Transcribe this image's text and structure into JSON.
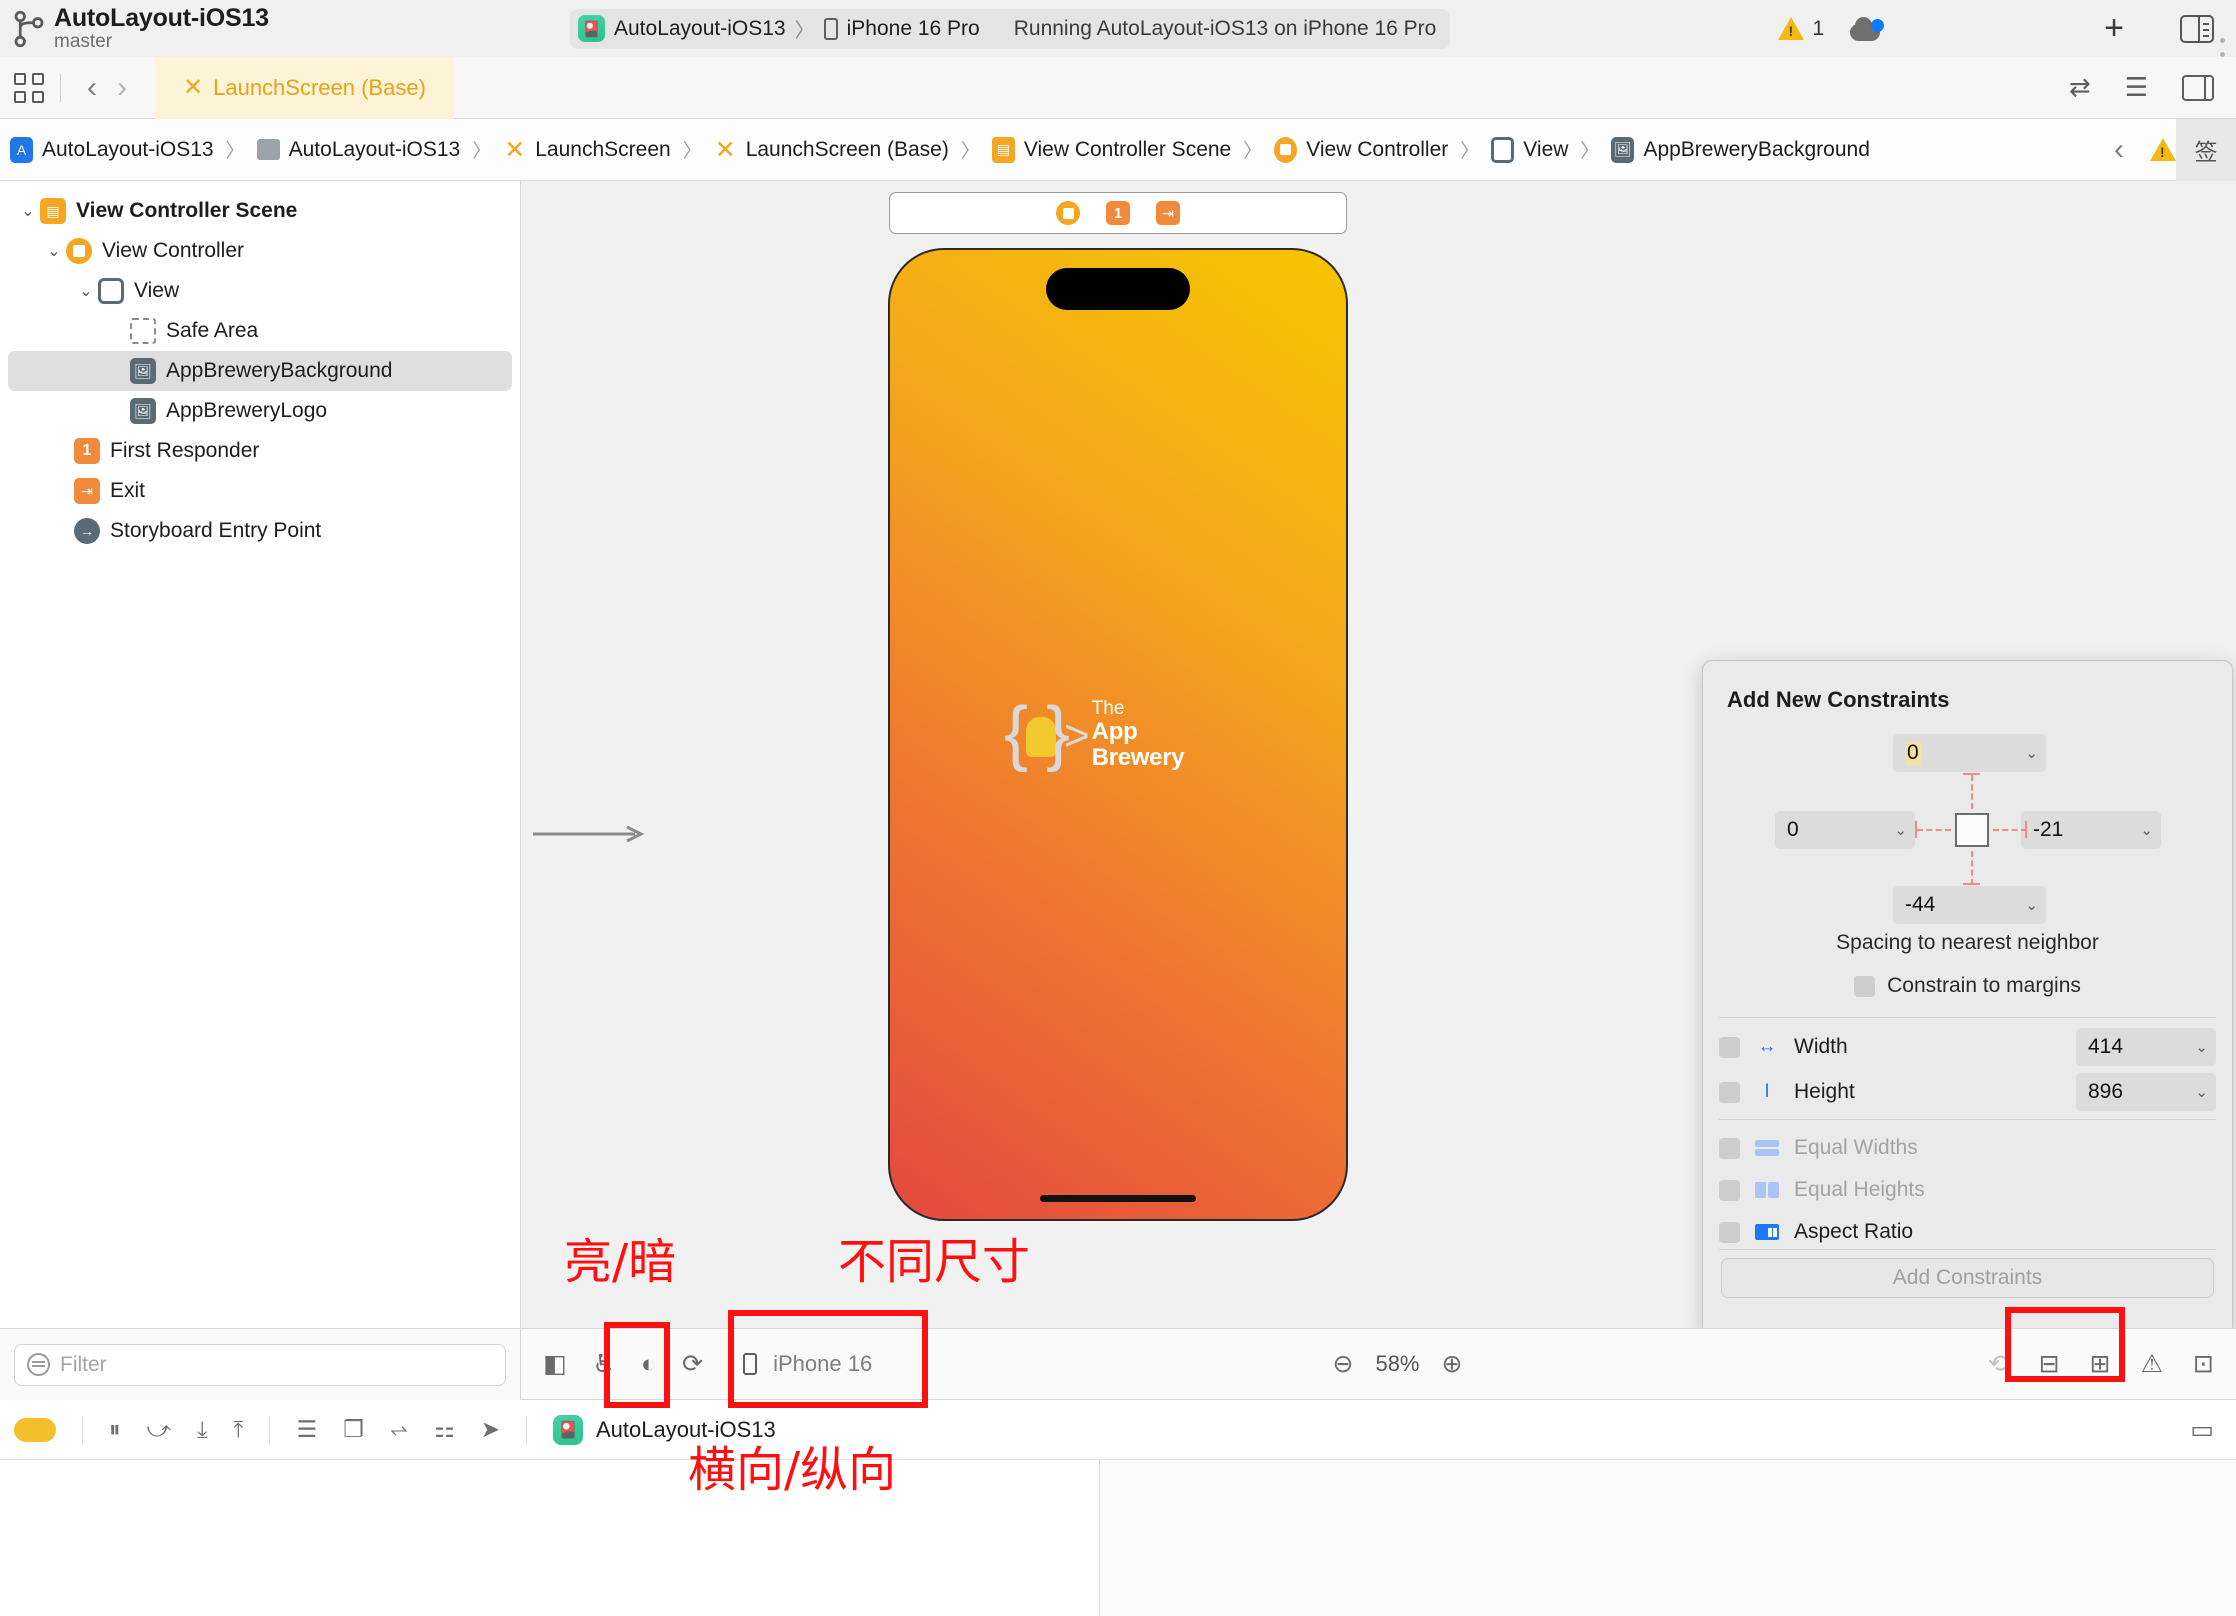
{
  "titlebar": {
    "project_name": "AutoLayout-iOS13",
    "branch": "master",
    "scheme": "AutoLayout-iOS13",
    "destination": "iPhone 16 Pro",
    "status": "Running AutoLayout-iOS13 on iPhone 16 Pro",
    "warning_count": "1",
    "chevron": "〉",
    "plus": "+"
  },
  "tabbar": {
    "back": "‹",
    "forward": "›",
    "tab_label": "LaunchScreen (Base)",
    "xib_glyph": "✕"
  },
  "breadcrumb": {
    "separator": "〉",
    "items": [
      {
        "label": "AutoLayout-iOS13",
        "icon": "xcodeproj-icon"
      },
      {
        "label": "AutoLayout-iOS13",
        "icon": "folder-icon"
      },
      {
        "label": "LaunchScreen",
        "icon": "xib-icon"
      },
      {
        "label": "LaunchScreen (Base)",
        "icon": "xib-icon"
      },
      {
        "label": "View Controller Scene",
        "icon": "scene-icon"
      },
      {
        "label": "View Controller",
        "icon": "view-controller-icon"
      },
      {
        "label": "View",
        "icon": "view-icon"
      },
      {
        "label": "AppBreweryBackground",
        "icon": "image-view-icon"
      }
    ],
    "nav_prev": "‹",
    "nav_next": "›"
  },
  "outline": {
    "items": [
      {
        "label": "View Controller Scene",
        "indent": 0,
        "twisty": "⌄",
        "icon": "scene-icon",
        "bold": true,
        "selected": false
      },
      {
        "label": "View Controller",
        "indent": 1,
        "twisty": "⌄",
        "icon": "view-controller-icon",
        "bold": false,
        "selected": false
      },
      {
        "label": "View",
        "indent": 2,
        "twisty": "⌄",
        "icon": "view-icon",
        "bold": false,
        "selected": false
      },
      {
        "label": "Safe Area",
        "indent": 3,
        "twisty": "",
        "icon": "safe-area-icon",
        "bold": false,
        "selected": false
      },
      {
        "label": "AppBreweryBackground",
        "indent": 3,
        "twisty": "",
        "icon": "image-view-icon",
        "bold": false,
        "selected": true
      },
      {
        "label": "AppBreweryLogo",
        "indent": 3,
        "twisty": "",
        "icon": "image-view-icon",
        "bold": false,
        "selected": false
      },
      {
        "label": "First Responder",
        "indent": 1,
        "twisty": "",
        "icon": "first-responder-icon",
        "bold": false,
        "selected": false
      },
      {
        "label": "Exit",
        "indent": 1,
        "twisty": "",
        "icon": "exit-icon",
        "bold": false,
        "selected": false
      },
      {
        "label": "Storyboard Entry Point",
        "indent": 1,
        "twisty": "",
        "icon": "entry-point-icon",
        "bold": false,
        "selected": false
      }
    ]
  },
  "canvas": {
    "logo_line1": "The",
    "logo_line2": "App Brewery",
    "dock_first_responder": "1",
    "gradient_top": "#f6c500",
    "gradient_bottom": "#e4483f"
  },
  "constraints": {
    "title": "Add New Constraints",
    "top_value": "0",
    "left_value": "0",
    "right_value": "-21",
    "bottom_value": "-44",
    "spacing_label": "Spacing to nearest neighbor",
    "margins_label": "Constrain to margins",
    "width_label": "Width",
    "width_value": "414",
    "height_label": "Height",
    "height_value": "896",
    "equal_widths_label": "Equal Widths",
    "equal_heights_label": "Equal Heights",
    "aspect_ratio_label": "Aspect Ratio",
    "add_button": "Add Constraints",
    "chevron": "⌄"
  },
  "canvasbar": {
    "device_label": "iPhone 16",
    "zoom_level": "58%",
    "zoom_out": "⊖",
    "zoom_in": "⊕"
  },
  "debugbar": {
    "filter_placeholder": "Filter",
    "app_label": "AutoLayout-iOS13"
  },
  "annotations": {
    "light_dark": "亮/暗",
    "different_sizes": "不同尺寸",
    "orientation": "横向/纵向"
  },
  "edge": {
    "partial_text": "签"
  }
}
